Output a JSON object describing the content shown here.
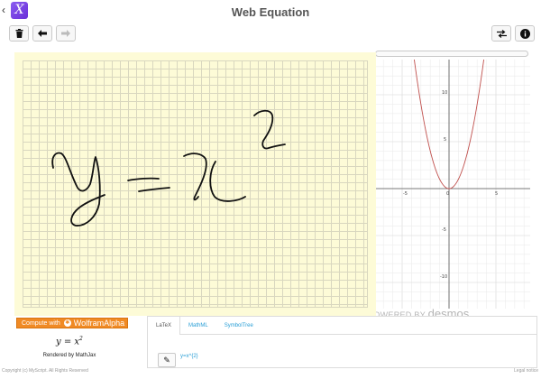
{
  "app": {
    "title": "Web Equation",
    "logo_letter": "X",
    "back_icon": "chevron-left-icon",
    "logo_color": "#7a45e6"
  },
  "toolbar": {
    "left_buttons": [
      {
        "name": "trash-icon",
        "glyph": "🗑",
        "enabled": true
      },
      {
        "name": "arrow-left-icon",
        "glyph": "🡐",
        "enabled": true
      },
      {
        "name": "arrow-right-icon",
        "glyph": "🡒",
        "enabled": false
      }
    ],
    "right_buttons": [
      {
        "name": "swap-icon",
        "glyph": "⇆"
      },
      {
        "name": "info-icon",
        "glyph": "ℹ"
      }
    ]
  },
  "graph": {
    "axis_ticks_x": [
      "-5",
      "0",
      "5"
    ],
    "axis_ticks_y": [
      "10",
      "5",
      "-5",
      "-10"
    ],
    "curve": "y = x^2",
    "curve_color": "#c0504d",
    "powered_prefix": "POWERED BY",
    "powered_brand": "desmos"
  },
  "pad": {
    "background": "#fdfbd7",
    "handwriting": "y = x^2"
  },
  "wolfram": {
    "label": "Compute with",
    "brand": "WolframAlpha"
  },
  "result": {
    "lhs": "y = x",
    "power": "2",
    "rendered_by": "Rendered by MathJax"
  },
  "output": {
    "tabs": [
      "LaTeX",
      "MathML",
      "SymbolTree"
    ],
    "active_tab": 0,
    "code": "y=x^{2}",
    "edit_icon": "pencil-icon"
  },
  "footer": {
    "left": "Copyright (c) MyScript. All Rights Reserved",
    "right": "Legal notice"
  }
}
